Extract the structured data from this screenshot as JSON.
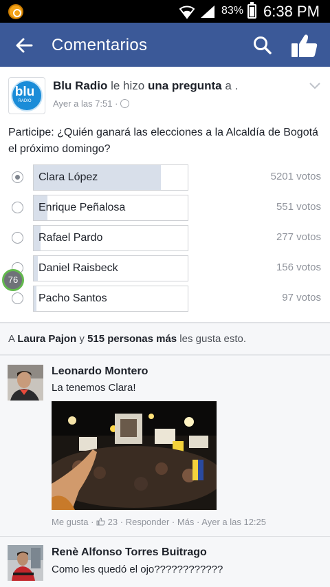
{
  "status_bar": {
    "battery": "83%",
    "time": "6:38 PM",
    "icons": [
      "app-icon",
      "wifi-icon",
      "signal-icon",
      "battery-icon"
    ]
  },
  "app_bar": {
    "title": "Comentarios",
    "color": "#3b5998",
    "icons": [
      "back-arrow-icon",
      "search-icon",
      "thumbs-up-icon"
    ]
  },
  "post": {
    "author": "Blu Radio",
    "avatar_text": "blu",
    "avatar_sub": "RADIO",
    "action_text": " le hizo ",
    "action_bold": "una pregunta",
    "action_tail": " a .",
    "time": "Ayer a las 7:51 ·",
    "question": "Participe: ¿Quién ganará las elecciones a la Alcaldía de Bogotá el próximo domingo?",
    "options": [
      {
        "label": "Clara López",
        "votes": "5201 votos",
        "share": 0.83,
        "selected": true
      },
      {
        "label": "Enrique Peñalosa",
        "votes": "551 votos",
        "share": 0.09,
        "selected": false
      },
      {
        "label": "Rafael Pardo",
        "votes": "277 votos",
        "share": 0.045,
        "selected": false
      },
      {
        "label": "Daniel Raisbeck",
        "votes": "156 votos",
        "share": 0.025,
        "selected": false
      },
      {
        "label": "Pacho Santos",
        "votes": "97 votos",
        "share": 0.016,
        "selected": false
      }
    ],
    "overlay_badge": "76"
  },
  "likes": {
    "prefix": "A ",
    "name": "Laura Pajon",
    "middle": " y ",
    "count_text": "515 personas más",
    "suffix": " les gusta esto."
  },
  "comments": [
    {
      "author": "Leonardo Montero",
      "text": "La tenemos Clara!",
      "has_photo": true,
      "actions": {
        "like": "Me gusta",
        "like_count": "23",
        "reply": "Responder",
        "more": "Más",
        "time": "Ayer a las 12:25"
      }
    },
    {
      "author": "Renè Alfonso Torres Buitrago",
      "text": "Como les quedó el ojo????????????",
      "has_photo": false
    }
  ]
}
